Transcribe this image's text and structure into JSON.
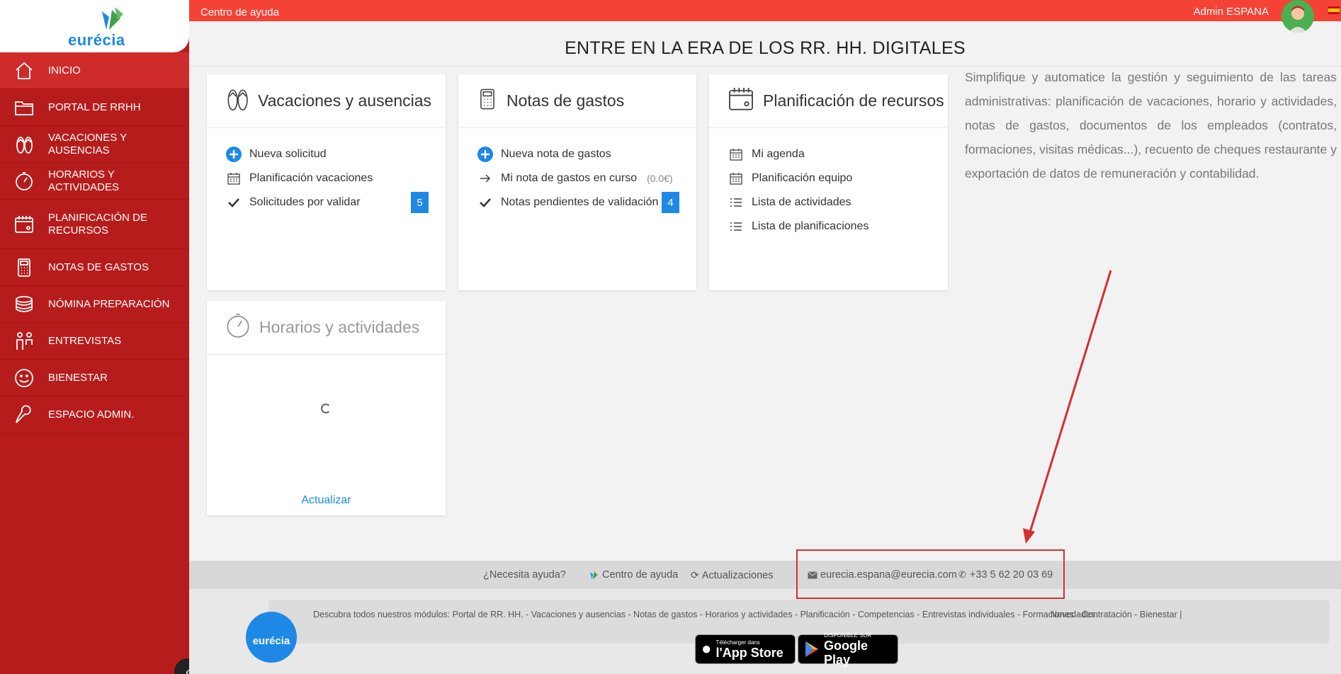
{
  "brand": {
    "name": "eurécia",
    "accent": "#f44336",
    "sidebar_color": "#b71c1c",
    "blue": "#1e88e5"
  },
  "topbar": {
    "help_label": "Centro de ayuda",
    "user_label": "Admin  ESPANA"
  },
  "sidebar": {
    "items": [
      {
        "label": "INICIO",
        "icon": "home-icon"
      },
      {
        "label": "PORTAL DE RRHH",
        "icon": "folder-icon"
      },
      {
        "label": "VACACIONES Y AUSENCIAS",
        "icon": "flip-flops-icon"
      },
      {
        "label": "HORARIOS Y ACTIVIDADES",
        "icon": "stopwatch-icon"
      },
      {
        "label": "PLANIFICACIÓN DE RECURSOS",
        "icon": "calendar-icon"
      },
      {
        "label": "NOTAS DE GASTOS",
        "icon": "calculator-icon"
      },
      {
        "label": "NÓMINA PREPARACIÓN",
        "icon": "coins-icon"
      },
      {
        "label": "ENTREVISTAS",
        "icon": "people-icon"
      },
      {
        "label": "BIENESTAR",
        "icon": "smiley-icon"
      },
      {
        "label": "ESPACIO ADMIN.",
        "icon": "wrench-icon"
      }
    ]
  },
  "headline": "ENTRE EN LA ERA DE LOS RR. HH. DIGITALES",
  "cards": {
    "vacaciones": {
      "title": "Vacaciones y ausencias",
      "rows": [
        "Nueva solicitud",
        "Planificación vacaciones",
        "Solicitudes por validar"
      ],
      "badge": "5"
    },
    "notas": {
      "title": "Notas de gastos",
      "rows": [
        "Nueva nota de gastos",
        "Mi nota de gastos en curso",
        "Notas pendientes de validación"
      ],
      "amount": "(0.0€)",
      "badge": "4"
    },
    "planificacion": {
      "title": "Planificación de recursos",
      "rows": [
        "Mi agenda",
        "Planificación equipo",
        "Lista de actividades",
        "Lista de planificaciones"
      ]
    },
    "horarios": {
      "title": "Horarios y actividades",
      "refresh_label": "Actualizar"
    }
  },
  "description": "Simplifique y automatice la gestión y seguimiento de las tareas administrativas: planificación de vacaciones, horario y actividades, notas de gastos, documentos de los empleados (contratos, formaciones, visitas médicas...), recuento de cheques restaurante y exportación de datos de remuneración y contabilidad.",
  "footer": {
    "need_help": "¿Necesita ayuda?",
    "help_center": "Centro de ayuda",
    "updates": "Actualizaciones",
    "email": "eurecia.espana@eurecia.com",
    "phone": "+33 5 62 20 03 69",
    "modules_text": "Descubra todos nuestros módulos: Portal de RR. HH. - Vacaciones y ausencias - Notas de gastos - Horarios y actividades - Planificación - Competencias - Entrevistas individuales - Formaciones - Contratación - Bienestar   |",
    "news": "Novedades",
    "appstore_small": "Télécharger dans",
    "appstore_big": "l'App Store",
    "googleplay_small": "DISPONIBLE SUR",
    "googleplay_big": "Google Play",
    "logo_text": "eurécia"
  }
}
